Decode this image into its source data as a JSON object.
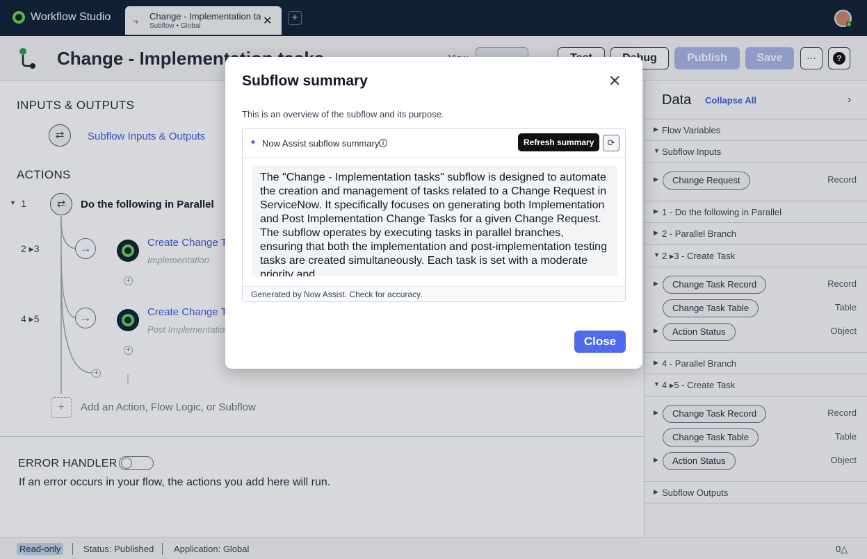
{
  "app": {
    "name": "Workflow Studio",
    "logo_icon": "workflow-studio-logo",
    "accent": "#62d84e"
  },
  "tabs": [
    {
      "title": "Change - Implementation tasks",
      "subtitle": "Subflow • Global",
      "icon": "subflow-icon"
    }
  ],
  "header": {
    "title": "Change - Implementation tasks",
    "view_label": "View",
    "buttons": {
      "test": "Test",
      "debug": "Debug",
      "publish": "Publish",
      "save": "Save",
      "more": "···",
      "help": "?"
    }
  },
  "canvas": {
    "inputs_outputs_title": "INPUTS & OUTPUTS",
    "inputs_outputs_link": "Subflow Inputs & Outputs",
    "actions_title": "ACTIONS",
    "step1": {
      "num": "1",
      "label": "Do the following in Parallel"
    },
    "step2": {
      "num": "2 ▸3",
      "label": "Create Change Ta",
      "sub": "Implementation"
    },
    "step3": {
      "num": "4 ▸5",
      "label": "Create Change Ta",
      "sub": "Post Implementatio"
    },
    "add_action": "Add an Action, Flow Logic, or Subflow",
    "error_title": "ERROR HANDLER",
    "error_desc": "If an error occurs in your flow, the actions you add here will run."
  },
  "data_panel": {
    "title": "Data",
    "collapse_all": "Collapse All",
    "rows": {
      "flow_vars": "Flow Variables",
      "subflow_inputs": "Subflow Inputs",
      "parallel1": "1 - Do the following in Parallel",
      "branch2": "2 - Parallel Branch",
      "create23": "2 ▸3 - Create Task",
      "branch4": "4 - Parallel Branch",
      "create45": "4 ▸5 - Create Task",
      "subflow_outputs": "Subflow Outputs"
    },
    "pills": {
      "change_request": {
        "label": "Change Request",
        "type": "Record"
      },
      "ctr1": {
        "label": "Change Task Record",
        "type": "Record"
      },
      "ctt1": {
        "label": "Change Task Table",
        "type": "Table"
      },
      "as1": {
        "label": "Action Status",
        "type": "Object"
      },
      "ctr2": {
        "label": "Change Task Record",
        "type": "Record"
      },
      "ctt2": {
        "label": "Change Task Table",
        "type": "Table"
      },
      "as2": {
        "label": "Action Status",
        "type": "Object"
      }
    }
  },
  "status_bar": {
    "read_only": "Read-only",
    "status": "Status: Published",
    "application": "Application: Global",
    "notifications": "0△"
  },
  "modal": {
    "title": "Subflow summary",
    "description": "This is an overview of the subflow and its purpose.",
    "summary_label": "Now Assist subflow summary",
    "tooltip": "Refresh summary",
    "summary_text": "The \"Change - Implementation tasks\" subflow is designed to automate the creation and management of tasks related to a Change Request in ServiceNow. It specifically focuses on generating both Implementation and Post Implementation Change Tasks for a given Change Request. The subflow operates by executing tasks in parallel branches, ensuring that both the implementation and post-implementation testing tasks are created simultaneously. Each task is set with a moderate priority and",
    "footer": "Generated by Now Assist. Check for accuracy.",
    "close_label": "Close"
  }
}
